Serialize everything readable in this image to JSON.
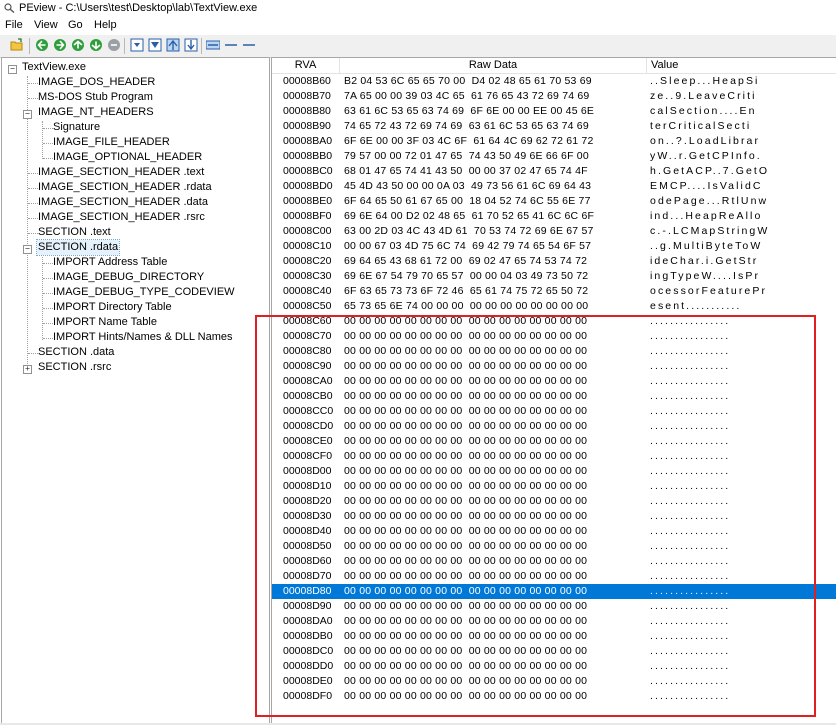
{
  "window": {
    "title": "PEview - C:\\Users\\test\\Desktop\\lab\\TextView.exe"
  },
  "menu": {
    "items": [
      "File",
      "View",
      "Go",
      "Help"
    ]
  },
  "toolbar": {
    "buttons": [
      "open-icon",
      "back-icon",
      "forward-icon",
      "up-icon",
      "down-icon",
      "home-icon",
      "byte-view-icon",
      "word-view-icon",
      "dword-view-icon",
      "qword-view-icon",
      "list-view-icon",
      "detail-view-icon",
      "grid-view-icon"
    ]
  },
  "tree": {
    "items": [
      {
        "label": "TextView.exe",
        "level": 0,
        "expander": "-"
      },
      {
        "label": "IMAGE_DOS_HEADER",
        "level": 1
      },
      {
        "label": "MS-DOS Stub Program",
        "level": 1
      },
      {
        "label": "IMAGE_NT_HEADERS",
        "level": 1,
        "expander": "-"
      },
      {
        "label": "Signature",
        "level": 2
      },
      {
        "label": "IMAGE_FILE_HEADER",
        "level": 2
      },
      {
        "label": "IMAGE_OPTIONAL_HEADER",
        "level": 2
      },
      {
        "label": "IMAGE_SECTION_HEADER .text",
        "level": 1
      },
      {
        "label": "IMAGE_SECTION_HEADER .rdata",
        "level": 1
      },
      {
        "label": "IMAGE_SECTION_HEADER .data",
        "level": 1
      },
      {
        "label": "IMAGE_SECTION_HEADER .rsrc",
        "level": 1
      },
      {
        "label": "SECTION .text",
        "level": 1
      },
      {
        "label": "SECTION .rdata",
        "level": 1,
        "expander": "-",
        "selected": true
      },
      {
        "label": "IMPORT Address Table",
        "level": 2
      },
      {
        "label": "IMAGE_DEBUG_DIRECTORY",
        "level": 2
      },
      {
        "label": "IMAGE_DEBUG_TYPE_CODEVIEW",
        "level": 2
      },
      {
        "label": "IMPORT Directory Table",
        "level": 2
      },
      {
        "label": "IMPORT Name Table",
        "level": 2
      },
      {
        "label": "IMPORT Hints/Names & DLL Names",
        "level": 2
      },
      {
        "label": "SECTION .data",
        "level": 1
      },
      {
        "label": "SECTION .rsrc",
        "level": 1,
        "expander": "+"
      }
    ]
  },
  "hex_view": {
    "headers": {
      "rva": "RVA",
      "raw": "Raw Data",
      "value": "Value"
    },
    "selected_row": "00008D80",
    "rows": [
      {
        "rva": "00008B60",
        "raw": "B2 04 53 6C 65 65 70 00  D4 02 48 65 61 70 53 69",
        "value": "..Sleep...HeapSi"
      },
      {
        "rva": "00008B70",
        "raw": "7A 65 00 00 39 03 4C 65  61 76 65 43 72 69 74 69",
        "value": "ze..9.LeaveCriti"
      },
      {
        "rva": "00008B80",
        "raw": "63 61 6C 53 65 63 74 69  6F 6E 00 00 EE 00 45 6E",
        "value": "calSection....En"
      },
      {
        "rva": "00008B90",
        "raw": "74 65 72 43 72 69 74 69  63 61 6C 53 65 63 74 69",
        "value": "terCriticalSecti"
      },
      {
        "rva": "00008BA0",
        "raw": "6F 6E 00 00 3F 03 4C 6F  61 64 4C 69 62 72 61 72",
        "value": "on..?.LoadLibrar"
      },
      {
        "rva": "00008BB0",
        "raw": "79 57 00 00 72 01 47 65  74 43 50 49 6E 66 6F 00",
        "value": "yW..r.GetCPInfo."
      },
      {
        "rva": "00008BC0",
        "raw": "68 01 47 65 74 41 43 50  00 00 37 02 47 65 74 4F",
        "value": "h.GetACP..7.GetO"
      },
      {
        "rva": "00008BD0",
        "raw": "45 4D 43 50 00 00 0A 03  49 73 56 61 6C 69 64 43",
        "value": "EMCP....IsValidC"
      },
      {
        "rva": "00008BE0",
        "raw": "6F 64 65 50 61 67 65 00  18 04 52 74 6C 55 6E 77",
        "value": "odePage...RtlUnw"
      },
      {
        "rva": "00008BF0",
        "raw": "69 6E 64 00 D2 02 48 65  61 70 52 65 41 6C 6C 6F",
        "value": "ind...HeapReAllo"
      },
      {
        "rva": "00008C00",
        "raw": "63 00 2D 03 4C 43 4D 61  70 53 74 72 69 6E 67 57",
        "value": "c.-.LCMapStringW"
      },
      {
        "rva": "00008C10",
        "raw": "00 00 67 03 4D 75 6C 74  69 42 79 74 65 54 6F 57",
        "value": "..g.MultiByteToW"
      },
      {
        "rva": "00008C20",
        "raw": "69 64 65 43 68 61 72 00  69 02 47 65 74 53 74 72",
        "value": "ideChar.i.GetStr"
      },
      {
        "rva": "00008C30",
        "raw": "69 6E 67 54 79 70 65 57  00 00 04 03 49 73 50 72",
        "value": "ingTypeW....IsPr"
      },
      {
        "rva": "00008C40",
        "raw": "6F 63 65 73 73 6F 72 46  65 61 74 75 72 65 50 72",
        "value": "ocessorFeaturePr"
      },
      {
        "rva": "00008C50",
        "raw": "65 73 65 6E 74 00 00 00  00 00 00 00 00 00 00 00",
        "value": "esent..........."
      },
      {
        "rva": "00008C60",
        "raw": "00 00 00 00 00 00 00 00  00 00 00 00 00 00 00 00",
        "value": "................"
      },
      {
        "rva": "00008C70",
        "raw": "00 00 00 00 00 00 00 00  00 00 00 00 00 00 00 00",
        "value": "................"
      },
      {
        "rva": "00008C80",
        "raw": "00 00 00 00 00 00 00 00  00 00 00 00 00 00 00 00",
        "value": "................"
      },
      {
        "rva": "00008C90",
        "raw": "00 00 00 00 00 00 00 00  00 00 00 00 00 00 00 00",
        "value": "................"
      },
      {
        "rva": "00008CA0",
        "raw": "00 00 00 00 00 00 00 00  00 00 00 00 00 00 00 00",
        "value": "................"
      },
      {
        "rva": "00008CB0",
        "raw": "00 00 00 00 00 00 00 00  00 00 00 00 00 00 00 00",
        "value": "................"
      },
      {
        "rva": "00008CC0",
        "raw": "00 00 00 00 00 00 00 00  00 00 00 00 00 00 00 00",
        "value": "................"
      },
      {
        "rva": "00008CD0",
        "raw": "00 00 00 00 00 00 00 00  00 00 00 00 00 00 00 00",
        "value": "................"
      },
      {
        "rva": "00008CE0",
        "raw": "00 00 00 00 00 00 00 00  00 00 00 00 00 00 00 00",
        "value": "................"
      },
      {
        "rva": "00008CF0",
        "raw": "00 00 00 00 00 00 00 00  00 00 00 00 00 00 00 00",
        "value": "................"
      },
      {
        "rva": "00008D00",
        "raw": "00 00 00 00 00 00 00 00  00 00 00 00 00 00 00 00",
        "value": "................"
      },
      {
        "rva": "00008D10",
        "raw": "00 00 00 00 00 00 00 00  00 00 00 00 00 00 00 00",
        "value": "................"
      },
      {
        "rva": "00008D20",
        "raw": "00 00 00 00 00 00 00 00  00 00 00 00 00 00 00 00",
        "value": "................"
      },
      {
        "rva": "00008D30",
        "raw": "00 00 00 00 00 00 00 00  00 00 00 00 00 00 00 00",
        "value": "................"
      },
      {
        "rva": "00008D40",
        "raw": "00 00 00 00 00 00 00 00  00 00 00 00 00 00 00 00",
        "value": "................"
      },
      {
        "rva": "00008D50",
        "raw": "00 00 00 00 00 00 00 00  00 00 00 00 00 00 00 00",
        "value": "................"
      },
      {
        "rva": "00008D60",
        "raw": "00 00 00 00 00 00 00 00  00 00 00 00 00 00 00 00",
        "value": "................"
      },
      {
        "rva": "00008D70",
        "raw": "00 00 00 00 00 00 00 00  00 00 00 00 00 00 00 00",
        "value": "................"
      },
      {
        "rva": "00008D80",
        "raw": "00 00 00 00 00 00 00 00  00 00 00 00 00 00 00 00",
        "value": "................"
      },
      {
        "rva": "00008D90",
        "raw": "00 00 00 00 00 00 00 00  00 00 00 00 00 00 00 00",
        "value": "................"
      },
      {
        "rva": "00008DA0",
        "raw": "00 00 00 00 00 00 00 00  00 00 00 00 00 00 00 00",
        "value": "................"
      },
      {
        "rva": "00008DB0",
        "raw": "00 00 00 00 00 00 00 00  00 00 00 00 00 00 00 00",
        "value": "................"
      },
      {
        "rva": "00008DC0",
        "raw": "00 00 00 00 00 00 00 00  00 00 00 00 00 00 00 00",
        "value": "................"
      },
      {
        "rva": "00008DD0",
        "raw": "00 00 00 00 00 00 00 00  00 00 00 00 00 00 00 00",
        "value": "................"
      },
      {
        "rva": "00008DE0",
        "raw": "00 00 00 00 00 00 00 00  00 00 00 00 00 00 00 00",
        "value": "................"
      },
      {
        "rva": "00008DF0",
        "raw": "00 00 00 00 00 00 00 00  00 00 00 00 00 00 00 00",
        "value": "................"
      }
    ]
  },
  "colors": {
    "selection": "#0078d7",
    "annotation": "#e02020",
    "tree_selected": "#cce8ff"
  }
}
